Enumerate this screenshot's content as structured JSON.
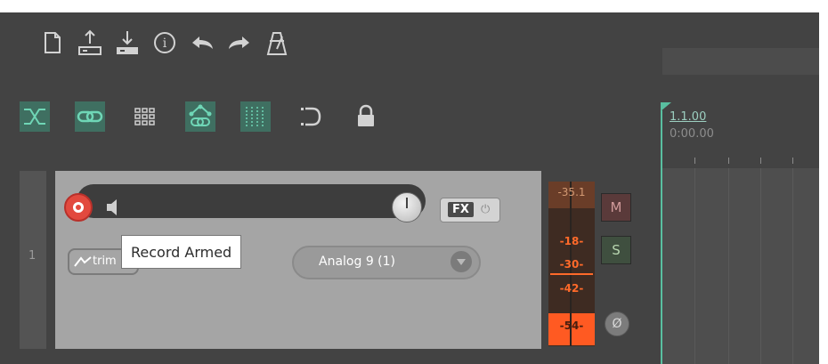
{
  "toolbar": {
    "row1": [
      {
        "icon": "new-project-icon"
      },
      {
        "icon": "open-project-icon"
      },
      {
        "icon": "save-project-icon"
      },
      {
        "icon": "project-info-icon"
      },
      {
        "icon": "undo-icon"
      },
      {
        "icon": "redo-icon"
      },
      {
        "icon": "metronome-icon"
      }
    ],
    "row2": [
      {
        "icon": "ripple-edit-icon",
        "active": true
      },
      {
        "icon": "item-grouping-icon",
        "active": true
      },
      {
        "icon": "grid-icon",
        "active": false
      },
      {
        "icon": "envelope-link-icon",
        "active": true
      },
      {
        "icon": "snap-grid-icon",
        "active": true
      },
      {
        "icon": "loop-icon",
        "active": false
      },
      {
        "icon": "lock-icon",
        "active": false
      }
    ]
  },
  "timeline": {
    "position_beats": "1.1.00",
    "position_time": "0:00.00"
  },
  "track": {
    "number": "1",
    "fx_label": "FX",
    "trim_label": "trim",
    "input_label": "Analog 9 (1)",
    "tooltip": "Record Armed",
    "mute_label": "M",
    "solo_label": "S",
    "phase_symbol": "Ø",
    "record_armed": true
  },
  "meter": {
    "peak": "-35.1",
    "scale": [
      "-18-",
      "-30-",
      "-42-",
      "-54-"
    ]
  },
  "colors": {
    "background": "#434343",
    "accent_teal": "#59bfa0",
    "record_red": "#e2493e",
    "meter_orange": "#ff5a22"
  }
}
